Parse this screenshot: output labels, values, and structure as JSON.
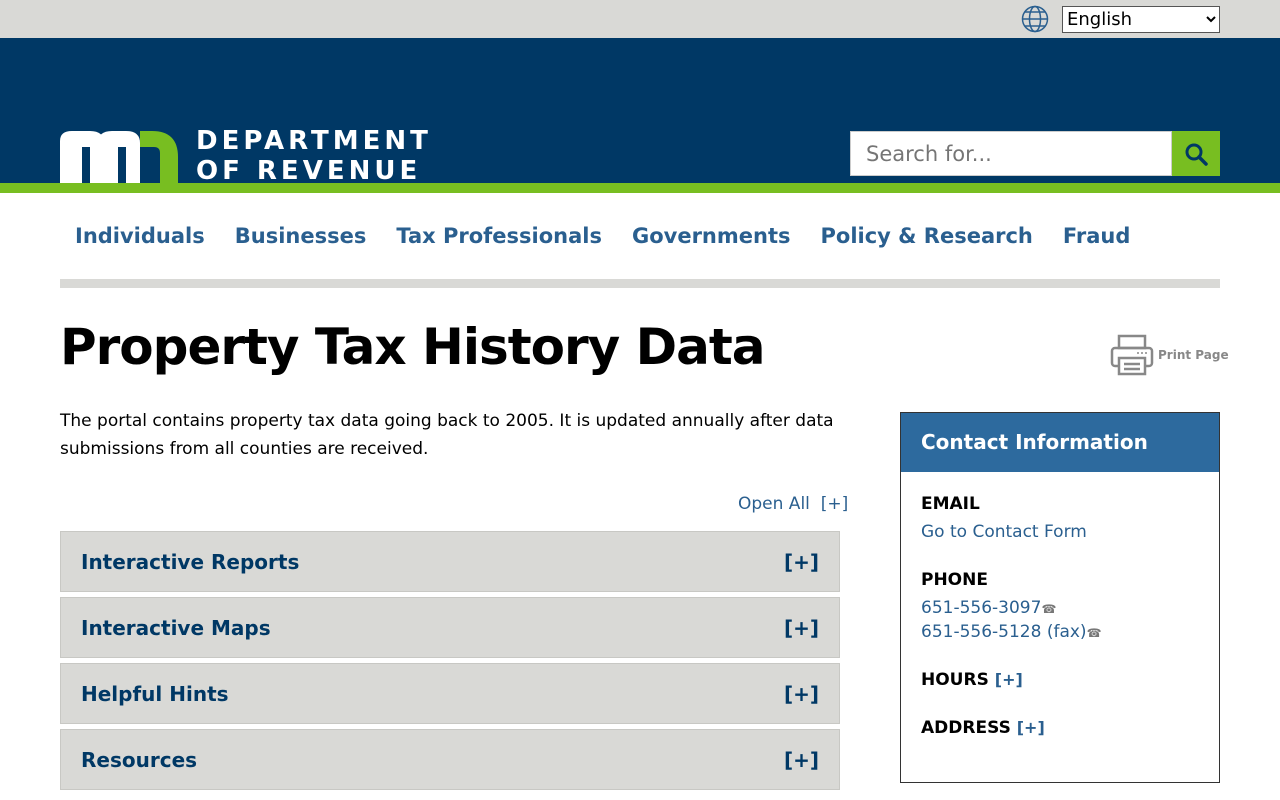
{
  "topbar": {
    "language": "English"
  },
  "header": {
    "logo_text_1": "DEPARTMENT",
    "logo_text_2": "OF REVENUE",
    "logo_letters": "mn",
    "search_placeholder": "Search for..."
  },
  "nav": [
    "Individuals",
    "Businesses",
    "Tax Professionals",
    "Governments",
    "Policy & Research",
    "Fraud"
  ],
  "page": {
    "title": "Property Tax History Data",
    "print": "Print Page",
    "intro": "The portal contains property tax data going back to 2005. It is updated annually after data submissions from all counties are received.",
    "open_all": "Open All  [+]"
  },
  "accordions": [
    {
      "label": "Interactive Reports",
      "toggle": "[+]"
    },
    {
      "label": "Interactive Maps",
      "toggle": "[+]"
    },
    {
      "label": "Helpful Hints",
      "toggle": "[+]"
    },
    {
      "label": "Resources",
      "toggle": "[+]"
    }
  ],
  "contact": {
    "title": "Contact Information",
    "email_label": "EMAIL",
    "email_link": "Go to Contact Form",
    "phone_label": "PHONE",
    "phone1": "651-556-3097",
    "phone2": "651-556-5128 (fax)",
    "hours_label": "HOURS",
    "address_label": "ADDRESS",
    "toggle": "[+]"
  }
}
